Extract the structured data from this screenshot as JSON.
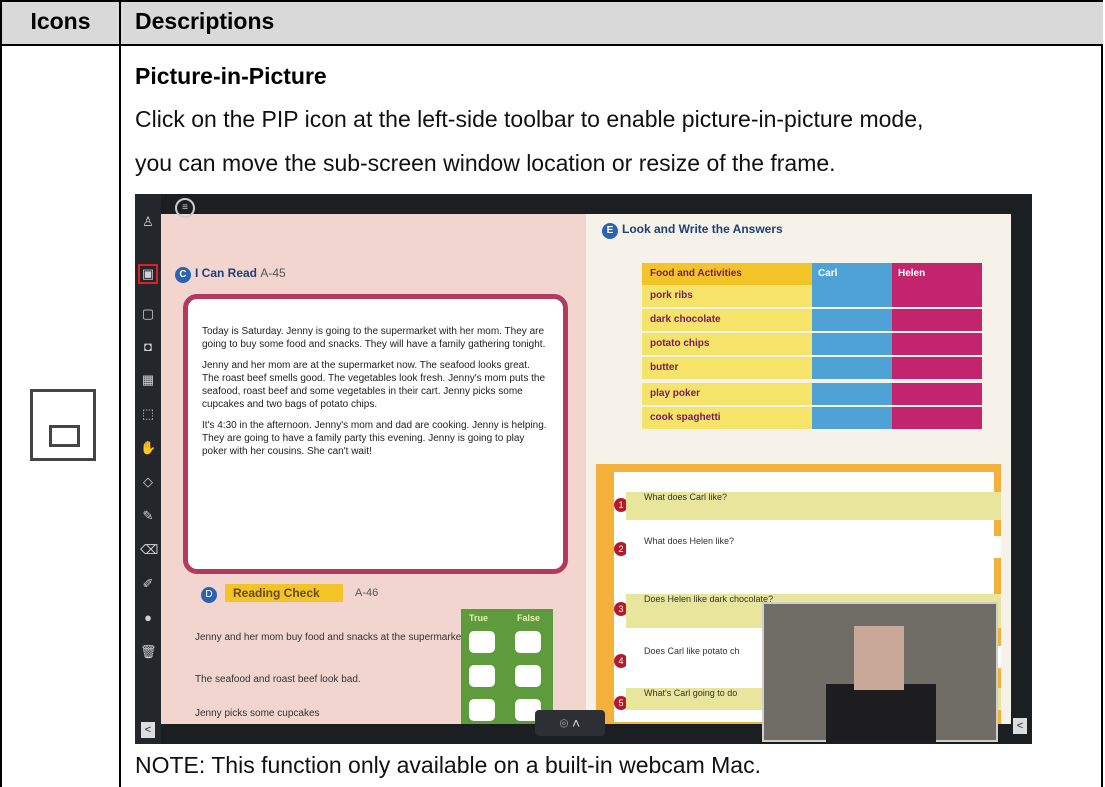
{
  "header": {
    "col1": "Icons",
    "col2": "Descriptions"
  },
  "content": {
    "title": "Picture-in-Picture",
    "body_line1": "Click on the PIP icon at the left-side toolbar to enable picture-in-picture mode,",
    "body_line2": "you can move the sub-screen window location or resize of the frame.",
    "note": "NOTE: This function only available on a built-in webcam Mac."
  },
  "icons": {
    "row_icon": "picture-in-picture-icon"
  },
  "screenshot": {
    "left_page": {
      "section_c": "I Can Read",
      "section_c_code": "A-45",
      "reading": [
        "Today is Saturday. Jenny is going to the supermarket with her mom. They are going to buy some food and snacks. They will have a family gathering tonight.",
        "Jenny and her mom are at the supermarket now. The seafood looks great. The roast beef smells good. The vegetables look fresh. Jenny's mom puts the seafood, roast beef and some vegetables in their cart. Jenny picks some cupcakes and two bags of potato chips.",
        "It's 4:30 in the afternoon. Jenny's mom and dad are cooking. Jenny is helping. They are going to have a family party this evening. Jenny is going to play poker with her cousins. She can't wait!"
      ],
      "section_d": "Reading Check",
      "section_d_code": "A-46",
      "true_label": "True",
      "false_label": "False",
      "statements": [
        "Jenny and her mom buy food and snacks at the supermarket.",
        "The seafood and roast beef look bad.",
        "Jenny picks some cupcakes"
      ]
    },
    "right_page": {
      "section_e": "Look and Write the Answers",
      "table_header": [
        "Food and Activities",
        "Carl",
        "Helen"
      ],
      "rows": [
        "pork ribs",
        "dark chocolate",
        "potato chips",
        "butter",
        "play poker",
        "cook spaghetti"
      ],
      "questions": [
        "What does Carl like?",
        "What does Helen like?",
        "Does Helen like dark chocolate?",
        "Does Carl like potato ch",
        "What's Carl going to do"
      ]
    }
  }
}
